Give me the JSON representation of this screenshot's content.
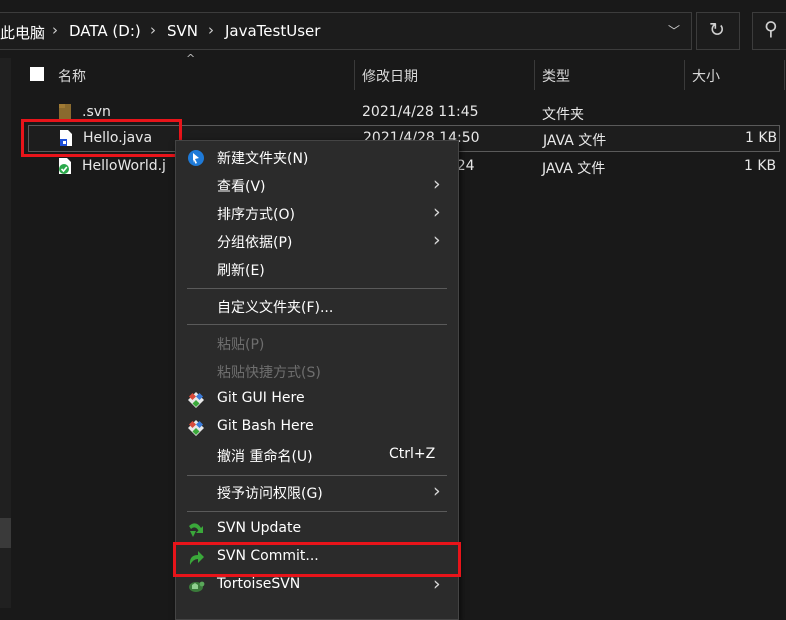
{
  "address_bar": {
    "crumbs": [
      "此电脑",
      "DATA (D:)",
      "SVN",
      "JavaTestUser"
    ]
  },
  "columns": {
    "name": "名称",
    "date": "修改日期",
    "type": "类型",
    "size": "大小"
  },
  "files": [
    {
      "name": ".svn",
      "date": "2021/4/28 11:45",
      "type": "文件夹",
      "size": "",
      "icon": "folder-icon"
    },
    {
      "name": "Hello.java",
      "date": "2021/4/28 14:50",
      "type": "JAVA 文件",
      "size": "1 KB",
      "icon": "java-file-added-icon"
    },
    {
      "name": "HelloWorld.j",
      "date": ":24",
      "type": "JAVA 文件",
      "size": "1 KB",
      "icon": "java-file-ok-icon"
    }
  ],
  "menu": {
    "new_folder": "新建文件夹(N)",
    "view": "查看(V)",
    "sort": "排序方式(O)",
    "group": "分组依据(P)",
    "refresh": "刷新(E)",
    "customize": "自定义文件夹(F)...",
    "paste": "粘贴(P)",
    "paste_shortcut": "粘贴快捷方式(S)",
    "git_gui": "Git GUI Here",
    "git_bash": "Git Bash Here",
    "undo_rename": "撤消 重命名(U)",
    "undo_shortcut": "Ctrl+Z",
    "grant_access": "授予访问权限(G)",
    "svn_update": "SVN Update",
    "svn_commit": "SVN Commit...",
    "tortoise": "TortoiseSVN"
  },
  "colors": {
    "background": "#191919",
    "menu_bg": "#2b2b2b",
    "highlight": "#e8141a",
    "svn_green": "#3aa83a"
  }
}
